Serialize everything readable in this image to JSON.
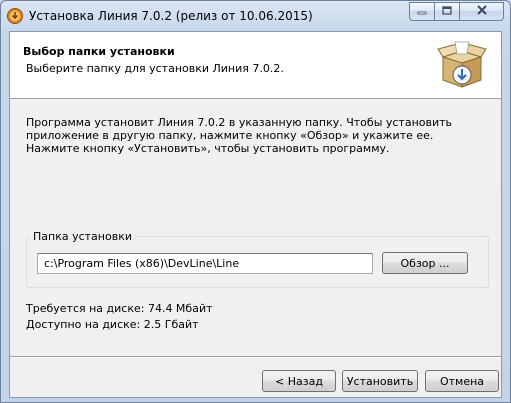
{
  "window": {
    "title": "Установка Линия 7.0.2 (релиз от 10.06.2015)",
    "app_icon": "installer-disc-icon",
    "caption_buttons": {
      "minimize_icon": "minimize-icon",
      "maximize_icon": "maximize-icon",
      "close_icon": "close-icon"
    }
  },
  "header": {
    "title": "Выбор папки установки",
    "subtitle": "Выберите папку для установки Линия 7.0.2.",
    "logo_icon": "install-box-icon"
  },
  "description": "Программа установит Линия 7.0.2 в указанную папку. Чтобы установить приложение в другую папку, нажмите кнопку «Обзор» и укажите ее. Нажмите кнопку «Установить», чтобы установить программу.",
  "install_folder": {
    "group_label": "Папка установки",
    "path": "c:\\Program Files (x86)\\DevLine\\Line",
    "browse_label": "Обзор ..."
  },
  "disk": {
    "required": "Требуется на диске: 74.4 Мбайт",
    "available": "Доступно на диске: 2.5 Гбайт"
  },
  "buttons": {
    "back": "< Назад",
    "install": "Установить",
    "cancel": "Отмена"
  },
  "colors": {
    "window_frame": "#c7d7ec",
    "client_bg": "#f0f0f0",
    "header_bg": "#ffffff"
  }
}
